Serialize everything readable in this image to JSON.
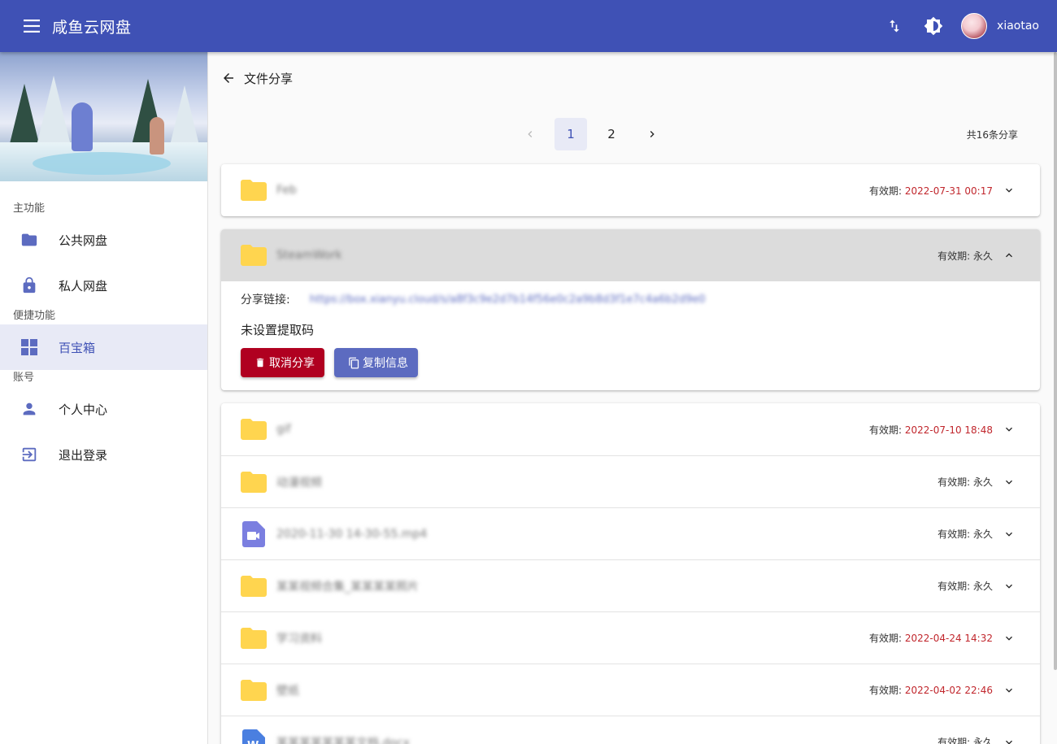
{
  "app": {
    "title": "咸鱼云网盘",
    "username": "xiaotao"
  },
  "sidebar": {
    "sections": {
      "main": "主功能",
      "quick": "便捷功能",
      "account": "账号"
    },
    "items": {
      "public": "公共网盘",
      "private": "私人网盘",
      "toolbox": "百宝箱",
      "profile": "个人中心",
      "logout": "退出登录"
    }
  },
  "page": {
    "title": "文件分享",
    "pages": [
      "1",
      "2"
    ],
    "current_page": "1",
    "total": "共16条分享"
  },
  "colors": {
    "primary": "#3f51b5",
    "accent": "#5c6bc0",
    "danger": "#b00020",
    "expired_date": "#c1272d",
    "folder": "#ffd54f"
  },
  "shares": [
    {
      "name": "Feb",
      "type": "folder",
      "expiry_label": "有效期:",
      "expiry": "2022-07-31 00:17",
      "dated": true
    },
    {
      "name": "SteamWork",
      "type": "folder",
      "expiry_label": "有效期:",
      "expiry": "永久",
      "dated": false,
      "link_label": "分享链接:",
      "link": "https://box.xianyu.cloud/s/a8f3c9e2d7b14f56e0c2a9b8d3f1e7c4a6b2d9e0",
      "code_status": "未设置提取码",
      "cancel_label": "取消分享",
      "copy_label": "复制信息"
    },
    {
      "name": "gif",
      "type": "folder",
      "expiry_label": "有效期:",
      "expiry": "2022-07-10 18:48",
      "dated": true
    },
    {
      "name": "动漫视频",
      "type": "folder",
      "expiry_label": "有效期:",
      "expiry": "永久",
      "dated": false
    },
    {
      "name": "2020-11-30 14-30-55.mp4",
      "type": "video",
      "expiry_label": "有效期:",
      "expiry": "永久",
      "dated": false
    },
    {
      "name": "某某视频合集_某某某某照片",
      "type": "folder",
      "expiry_label": "有效期:",
      "expiry": "永久",
      "dated": false
    },
    {
      "name": "学习资料",
      "type": "folder",
      "expiry_label": "有效期:",
      "expiry": "2022-04-24 14:32",
      "dated": true
    },
    {
      "name": "壁纸",
      "type": "folder",
      "expiry_label": "有效期:",
      "expiry": "2022-04-02 22:46",
      "dated": true
    },
    {
      "name": "某某某某某某某文档.docx",
      "type": "word",
      "expiry_label": "有效期:",
      "expiry": "永久",
      "dated": false
    }
  ]
}
